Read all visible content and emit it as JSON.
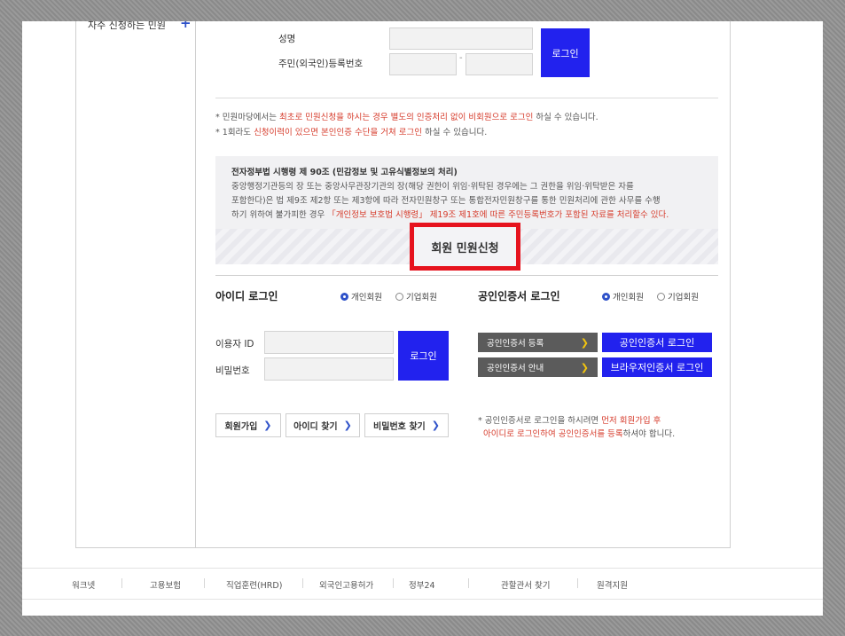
{
  "sidebar": {
    "item_label": "자주 신청하는 민원",
    "plus": "+"
  },
  "nonmember": {
    "name_label": "성명",
    "rrn_label": "주민(외국인)등록번호",
    "rrn_dash": "-",
    "login_label": "로그인"
  },
  "notice": {
    "line1_a": "* 민원마당에서는 ",
    "line1_b": "최초로 민원신청을 하시는 경우 별도의 인증처리 없이 비회원으로 로그인",
    "line1_c": " 하실 수 있습니다.",
    "line2_a": "* 1회라도 ",
    "line2_b": "신청이력이 있으면 본인인증 수단을 거쳐 로그인",
    "line2_c": " 하실 수 있습니다."
  },
  "law": {
    "title": "전자정부법 시행령 제 90조 (민감정보 및 고유식별정보의 처리)",
    "line1": "중앙행정기관등의 장 또는 중앙사무관장기관의 장(해당 권한이 위임·위탁된 경우에는 그 권한을 위임·위탁받은 자를",
    "line2": "포함한다)은 법 제9조 제2항 또는 제3항에 따라 전자민원창구 또는 통합전자민원창구를 통한 민원처리에 관한 사무를 수행",
    "line3_a": "하기 위하여 불가피한 경우 ",
    "line3_b": "「개인정보 보호법 시행령」 제19조 제1호에 따른 주민등록번호가 포함된 자료를 처리할수 있다."
  },
  "apply_button": "회원 민원신청",
  "id_login": {
    "title": "아이디 로그인",
    "radio_personal": "개인회원",
    "radio_corporate": "기업회원",
    "user_id_label": "이용자 ID",
    "password_label": "비밀번호",
    "login_label": "로그인",
    "signup": "회원가입",
    "find_id": "아이디 찾기",
    "find_pw": "비밀번호 찾기"
  },
  "cert_login": {
    "title": "공인인증서 로그인",
    "radio_personal": "개인회원",
    "radio_corporate": "기업회원",
    "register": "공인인증서 등록",
    "guide": "공인인증서 안내",
    "cert_login": "공인인증서 로그인",
    "browser_login": "브라우저인증서 로그인",
    "note1_a": "* 공인인증서로 로그인을 하시려면 ",
    "note1_b": "먼저 회원가입 후",
    "note2_a": "아이디로 로그인하여 공인인증서를 등록",
    "note2_b": "하셔야 합니다."
  },
  "footer": [
    "워크넷",
    "고용보험",
    "직업훈련(HRD)",
    "외국인고용허가",
    "정부24",
    "관할관서 찾기",
    "원격지원"
  ]
}
